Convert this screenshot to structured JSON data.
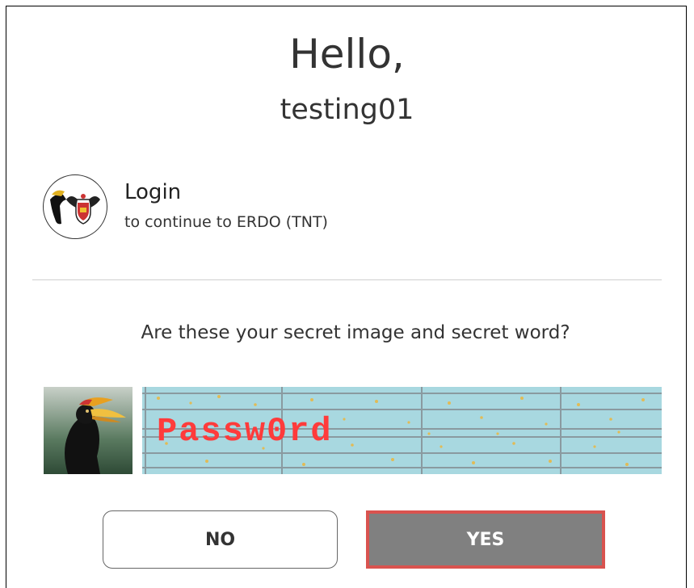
{
  "greeting": {
    "hello": "Hello,",
    "username": "testing01"
  },
  "app": {
    "title": "Login",
    "subtitle": "to continue to ERDO (TNT)",
    "logo_icon": "university-crest-icon"
  },
  "prompt": {
    "question": "Are these your secret image and secret word?"
  },
  "secret": {
    "image_icon": "hornbill-bird-image",
    "word": "Passw0rd"
  },
  "buttons": {
    "no_label": "NO",
    "yes_label": "YES"
  },
  "colors": {
    "yes_bg": "#808080",
    "yes_border": "#d9534f",
    "captcha_bg": "#a8d8e0",
    "captcha_text": "#ff3b3b"
  }
}
